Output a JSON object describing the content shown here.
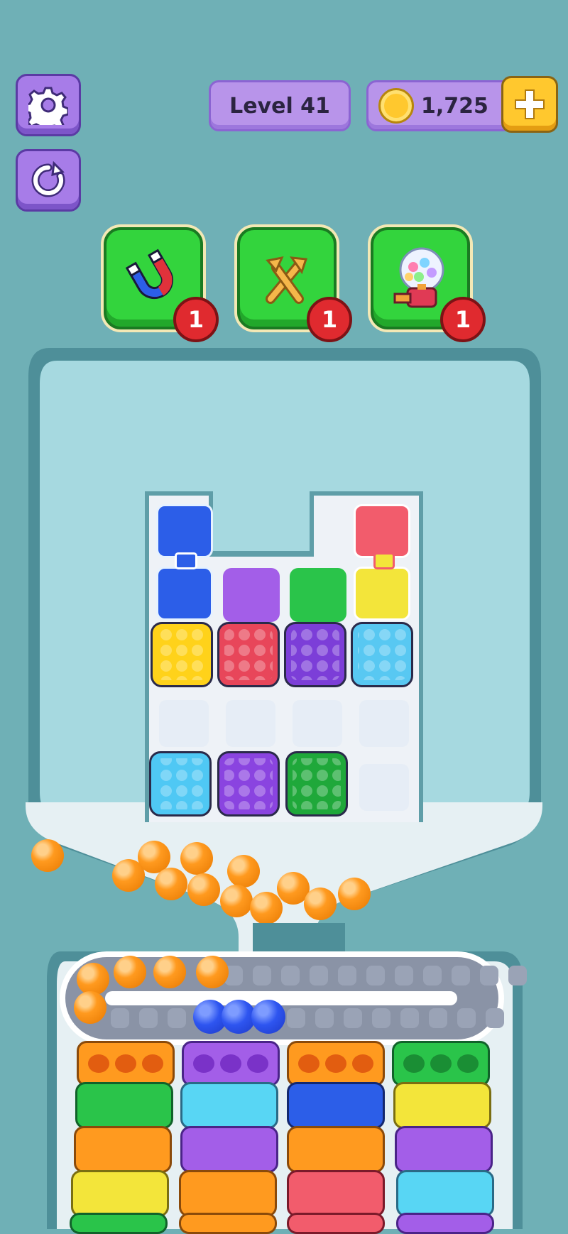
{
  "header": {
    "level_label": "Level 41",
    "coins": "1,725"
  },
  "boosters": [
    {
      "name": "magnet",
      "count": "1"
    },
    {
      "name": "swap",
      "count": "1"
    },
    {
      "name": "gumball-machine",
      "count": "1"
    }
  ],
  "colors": {
    "background": "#6fb0b6",
    "ball_orange": "#ff9a1f",
    "ball_blue": "#2e55f0",
    "booster_green": "#33d43d",
    "button_purple": "#a77ce8"
  }
}
